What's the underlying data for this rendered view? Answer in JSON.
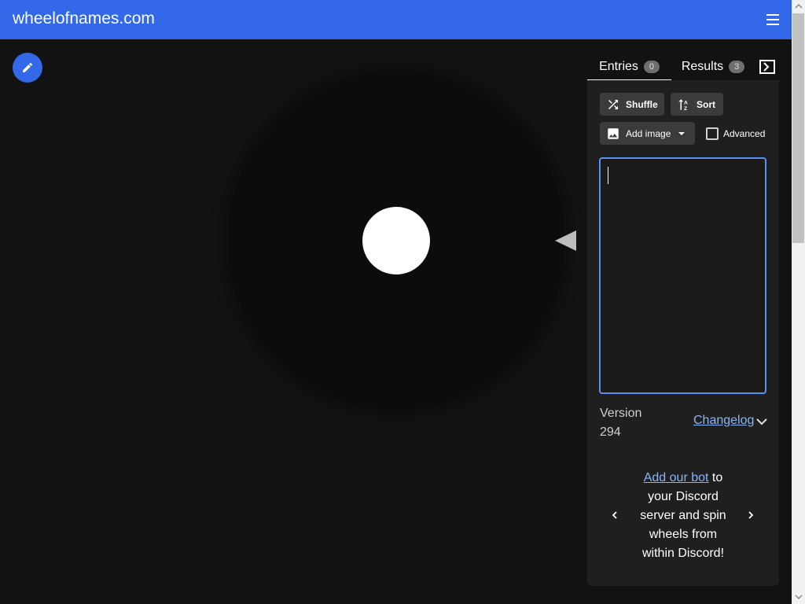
{
  "header": {
    "site_title": "wheelofnames.com"
  },
  "tabs": {
    "entries_label": "Entries",
    "entries_count": "0",
    "results_label": "Results",
    "results_count": "3"
  },
  "toolbar": {
    "shuffle_label": "Shuffle",
    "sort_label": "Sort",
    "add_image_label": "Add image",
    "advanced_label": "Advanced",
    "advanced_checked": false
  },
  "entries": {
    "value": ""
  },
  "footer": {
    "version_label": "Version",
    "version_number": "294",
    "changelog_label": "Changelog"
  },
  "promo": {
    "link_text": "Add our bot",
    "text_1": " to",
    "text_2": "your Discord",
    "text_3": "server and spin",
    "text_4": "wheels from",
    "text_5": "within Discord!"
  },
  "icons": [
    "menu-icon",
    "pencil-icon",
    "shuffle-icon",
    "sort-icon",
    "image-icon",
    "caret-down-icon",
    "collapse-panel-icon",
    "chevron-down-icon",
    "chevron-left-icon",
    "chevron-right-icon"
  ],
  "colors": {
    "accent": "#3369e8",
    "link": "#8ab4f8",
    "background": "#121212",
    "panel": "#1f1f1f"
  }
}
